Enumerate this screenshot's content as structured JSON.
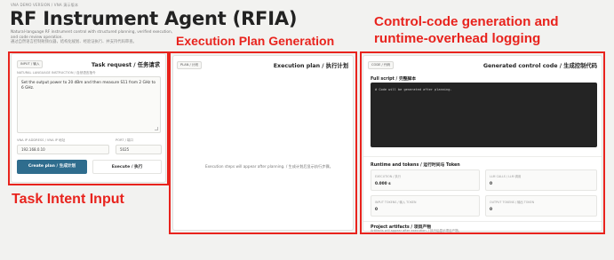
{
  "header": {
    "breadcrumb": "VNA DEMO VERSION / VNA 演示版本",
    "title": "RF Instrument Agent (RFIA)",
    "subtitle_en": "Natural-language RF instrument control with structured planning, verified execution, and code review operation.",
    "subtitle_zh": "通过自然语言控制射频仪器，结构化规划、经验证执行、并支持代码审查。"
  },
  "annotations": {
    "plan": "Execution Plan Generation",
    "control": "Control-code generation and runtime-overhead logging",
    "task": "Task Intent Input"
  },
  "input_panel": {
    "chip": "INPUT / 输入",
    "title": "Task request / 任务请求",
    "instruction_label": "NATURAL LANGUAGE INSTRUCTION / 自然语言指令",
    "instruction_value": "Set the output power to 20 dBm and then measure S11 from 2 GHz to 6 GHz.",
    "ip_label": "VNA IP ADDRESS / VNA IP 地址",
    "ip_value": "192.168.0.10",
    "port_label": "PORT / 端口",
    "port_value": "5025",
    "create_button": "Create plan / 生成计划",
    "execute_button": "Execute / 执行"
  },
  "plan_panel": {
    "chip": "PLAN / 计划",
    "title": "Execution plan / 执行计划",
    "empty_text": "Execution steps will appear after planning. / 生成计划后显示执行步骤。"
  },
  "code_panel": {
    "chip": "CODE / 代码",
    "title": "Generated control code / 生成控制代码",
    "script_label": "Full script / 完整脚本",
    "script_placeholder": "# Code will be generated after planning.",
    "runtime_title": "Runtime and tokens / 运行时间与 Token",
    "metrics": [
      {
        "key": "EXECUTION / 执行",
        "value": "0.000 s"
      },
      {
        "key": "LLM CALLS / LLM 调用",
        "value": "0"
      },
      {
        "key": "INPUT TOKENS / 输入 TOKEN",
        "value": "0"
      },
      {
        "key": "OUTPUT TOKENS / 输出 TOKEN",
        "value": "0"
      }
    ],
    "artifacts_title": "Project artifacts / 项目产物",
    "artifacts_text": "Artifacts will appear after execution. / 执行后显示项目产物。"
  },
  "colors": {
    "annotation": "#e8231d",
    "primary_button": "#2f6d8e",
    "code_bg": "#242424"
  }
}
